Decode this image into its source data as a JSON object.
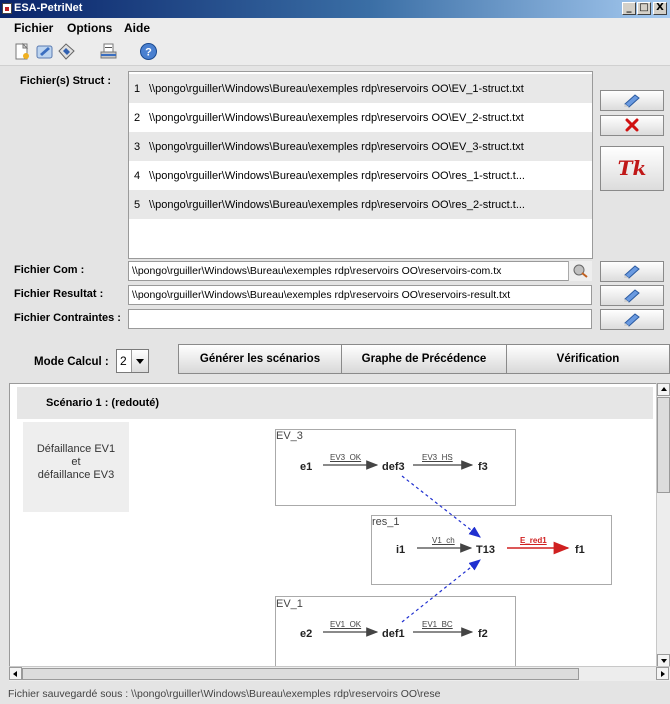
{
  "window": {
    "title": "ESA-PetriNet",
    "controls": [
      "_",
      "□",
      "X"
    ]
  },
  "menu": [
    "Fichier",
    "Options",
    "Aide"
  ],
  "toolbar": {
    "icons": [
      "new-file-icon",
      "open-icon",
      "edit-icon",
      "save-icon",
      "help-icon"
    ]
  },
  "struct": {
    "label": "Fichier(s) Struct :",
    "files": [
      {
        "n": "1",
        "path": "\\\\pongo\\rguiller\\Windows\\Bureau\\exemples rdp\\reservoirs OO\\EV_1-struct.txt"
      },
      {
        "n": "2",
        "path": "\\\\pongo\\rguiller\\Windows\\Bureau\\exemples rdp\\reservoirs OO\\EV_2-struct.txt"
      },
      {
        "n": "3",
        "path": "\\\\pongo\\rguiller\\Windows\\Bureau\\exemples rdp\\reservoirs OO\\EV_3-struct.txt"
      },
      {
        "n": "4",
        "path": "\\\\pongo\\rguiller\\Windows\\Bureau\\exemples rdp\\reservoirs OO\\res_1-struct.t..."
      },
      {
        "n": "5",
        "path": "\\\\pongo\\rguiller\\Windows\\Bureau\\exemples rdp\\reservoirs OO\\res_2-struct.t..."
      }
    ],
    "tk_label": "Tk"
  },
  "com": {
    "label": "Fichier Com :",
    "value": "\\\\pongo\\rguiller\\Windows\\Bureau\\exemples rdp\\reservoirs OO\\reservoirs-com.tx"
  },
  "result": {
    "label": "Fichier Resultat :",
    "value": "\\\\pongo\\rguiller\\Windows\\Bureau\\exemples rdp\\reservoirs OO\\reservoirs-result.txt"
  },
  "constraints": {
    "label": "Fichier Contraintes :",
    "value": ""
  },
  "mode": {
    "label": "Mode Calcul :",
    "value": "2"
  },
  "buttons": {
    "generate": "Générer les scénarios",
    "precedence": "Graphe de Précédence",
    "verify": "Vérification"
  },
  "scenario": {
    "title": "Scénario 1 : (redouté)",
    "failure_lines": [
      "Défaillance EV1",
      "et",
      "défaillance EV3"
    ],
    "nets": {
      "ev3": {
        "name": "EV_3",
        "nodes": [
          "e1",
          "def3",
          "f3"
        ],
        "arcs": [
          "EV3_OK",
          "EV3_HS"
        ]
      },
      "res1": {
        "name": "res_1",
        "nodes": [
          "i1",
          "T13",
          "f1"
        ],
        "arcs": [
          "V1_ch",
          "E_red1"
        ]
      },
      "ev1": {
        "name": "EV_1",
        "nodes": [
          "e2",
          "def1",
          "f2"
        ],
        "arcs": [
          "EV1_OK",
          "EV1_BC"
        ]
      }
    }
  },
  "status": "Fichier sauvegardé sous : \\\\pongo\\rguiller\\Windows\\Bureau\\exemples rdp\\reservoirs OO\\rese",
  "colors": {
    "title_bar": "#0a246a",
    "red_arc": "#d02020",
    "blue_dashed": "#2030d0"
  }
}
